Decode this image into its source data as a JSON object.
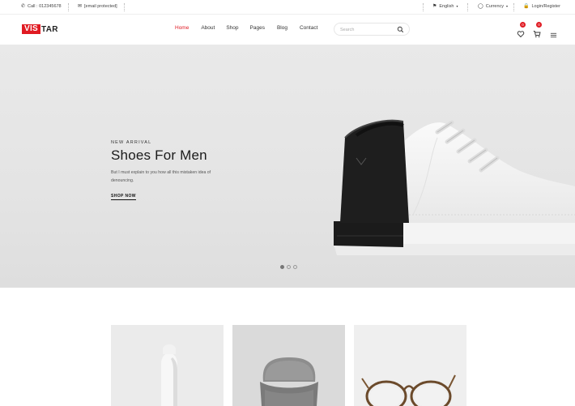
{
  "topbar": {
    "phone": "Call : 012345678",
    "email": "[email protected]",
    "language": "English",
    "currency": "Currency",
    "account": "Login/Register"
  },
  "header": {
    "logo_highlight": "VIS",
    "logo_rest": "TAR",
    "nav": [
      "Home",
      "About",
      "Shop",
      "Pages",
      "Blog",
      "Contact"
    ],
    "active_nav": "Home",
    "search_placeholder": "Search",
    "wishlist_count": "0",
    "cart_count": "0"
  },
  "hero": {
    "kicker": "NEW ARRIVAL",
    "title": "Shoes For Men",
    "description": "But I must explain to you how all this mistaken idea of denouncing.",
    "cta": "SHOP NOW",
    "slides": 3,
    "active_slide": 1
  },
  "products": [
    {
      "image": "hook-product-image"
    },
    {
      "image": "chair-product-image"
    },
    {
      "image": "glasses-product-image"
    }
  ],
  "colors": {
    "accent": "#e01a22",
    "hero_bg": "#e6e6e6",
    "card_bg": "#e9e9e9"
  }
}
